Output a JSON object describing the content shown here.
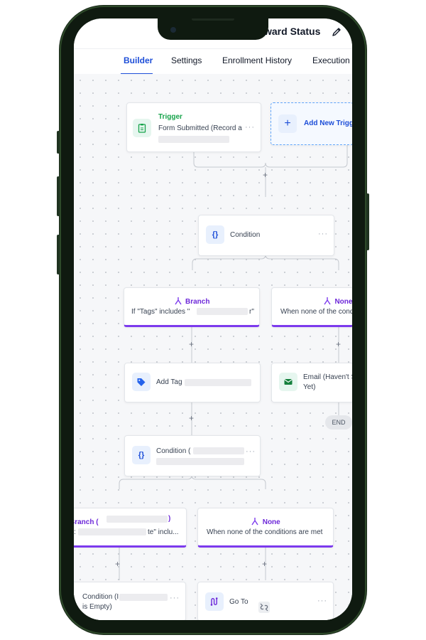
{
  "header": {
    "title": "ward Status"
  },
  "tabs": [
    "Builder",
    "Settings",
    "Enrollment History",
    "Execution"
  ],
  "trigger": {
    "type": "Trigger",
    "text": "Form Submitted (Record a",
    "more": "···"
  },
  "add_trigger": {
    "label": "Add New Trigge"
  },
  "condition1": {
    "label": "Condition",
    "more": "···"
  },
  "branch1": {
    "heading": "Branch",
    "text": "If \"Tags\" includes \"",
    "tail": "r\""
  },
  "none1": {
    "heading": "None",
    "text": "When none of the cond"
  },
  "add_tag": {
    "label": "Add Tag",
    "more": "···"
  },
  "email": {
    "line1": "Email (Haven't S",
    "line2": "Yet)"
  },
  "end_label": "END",
  "condition2": {
    "label": "Condition (",
    "more": "···"
  },
  "branch2": {
    "heading": "Branch (",
    "heading_tail": ")",
    "text_tail": "te\" inclu..."
  },
  "none2": {
    "heading": "None",
    "text": "When none of the conditions are met"
  },
  "condition3": {
    "line1": "Condition (I",
    "line2": "is Empty)",
    "more": "···"
  },
  "goto": {
    "label": "Go To",
    "more": "···"
  },
  "plus": "+",
  "colors": {
    "accent": "#1d4ed8",
    "branch": "#7c3aed",
    "trigger": "#16a34a"
  }
}
